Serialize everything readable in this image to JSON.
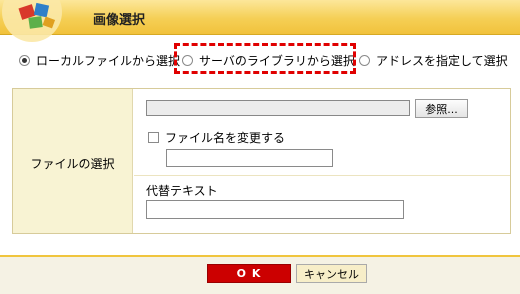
{
  "dialog": {
    "title": "画像選択",
    "logo_icon": "picture-blocks-icon"
  },
  "source_options": [
    {
      "label": "ローカルファイルから選択",
      "selected": true
    },
    {
      "label": "サーバのライブラリから選択",
      "selected": false
    },
    {
      "label": "アドレスを指定して選択",
      "selected": false
    }
  ],
  "file_section": {
    "label": "ファイルの選択",
    "file_value": "",
    "browse_label": "参照...",
    "rename_checkbox_label": "ファイル名を変更する",
    "rename_checked": false,
    "rename_value": "",
    "alt_text_label": "代替テキスト",
    "alt_text_value": ""
  },
  "buttons": {
    "ok_label": "O K",
    "cancel_label": "キャンセル"
  },
  "colors": {
    "title_bar": "#f5cf55",
    "highlight": "#e00000",
    "ok_button": "#cc0000",
    "panel_label_bg": "#f8f3d3"
  }
}
